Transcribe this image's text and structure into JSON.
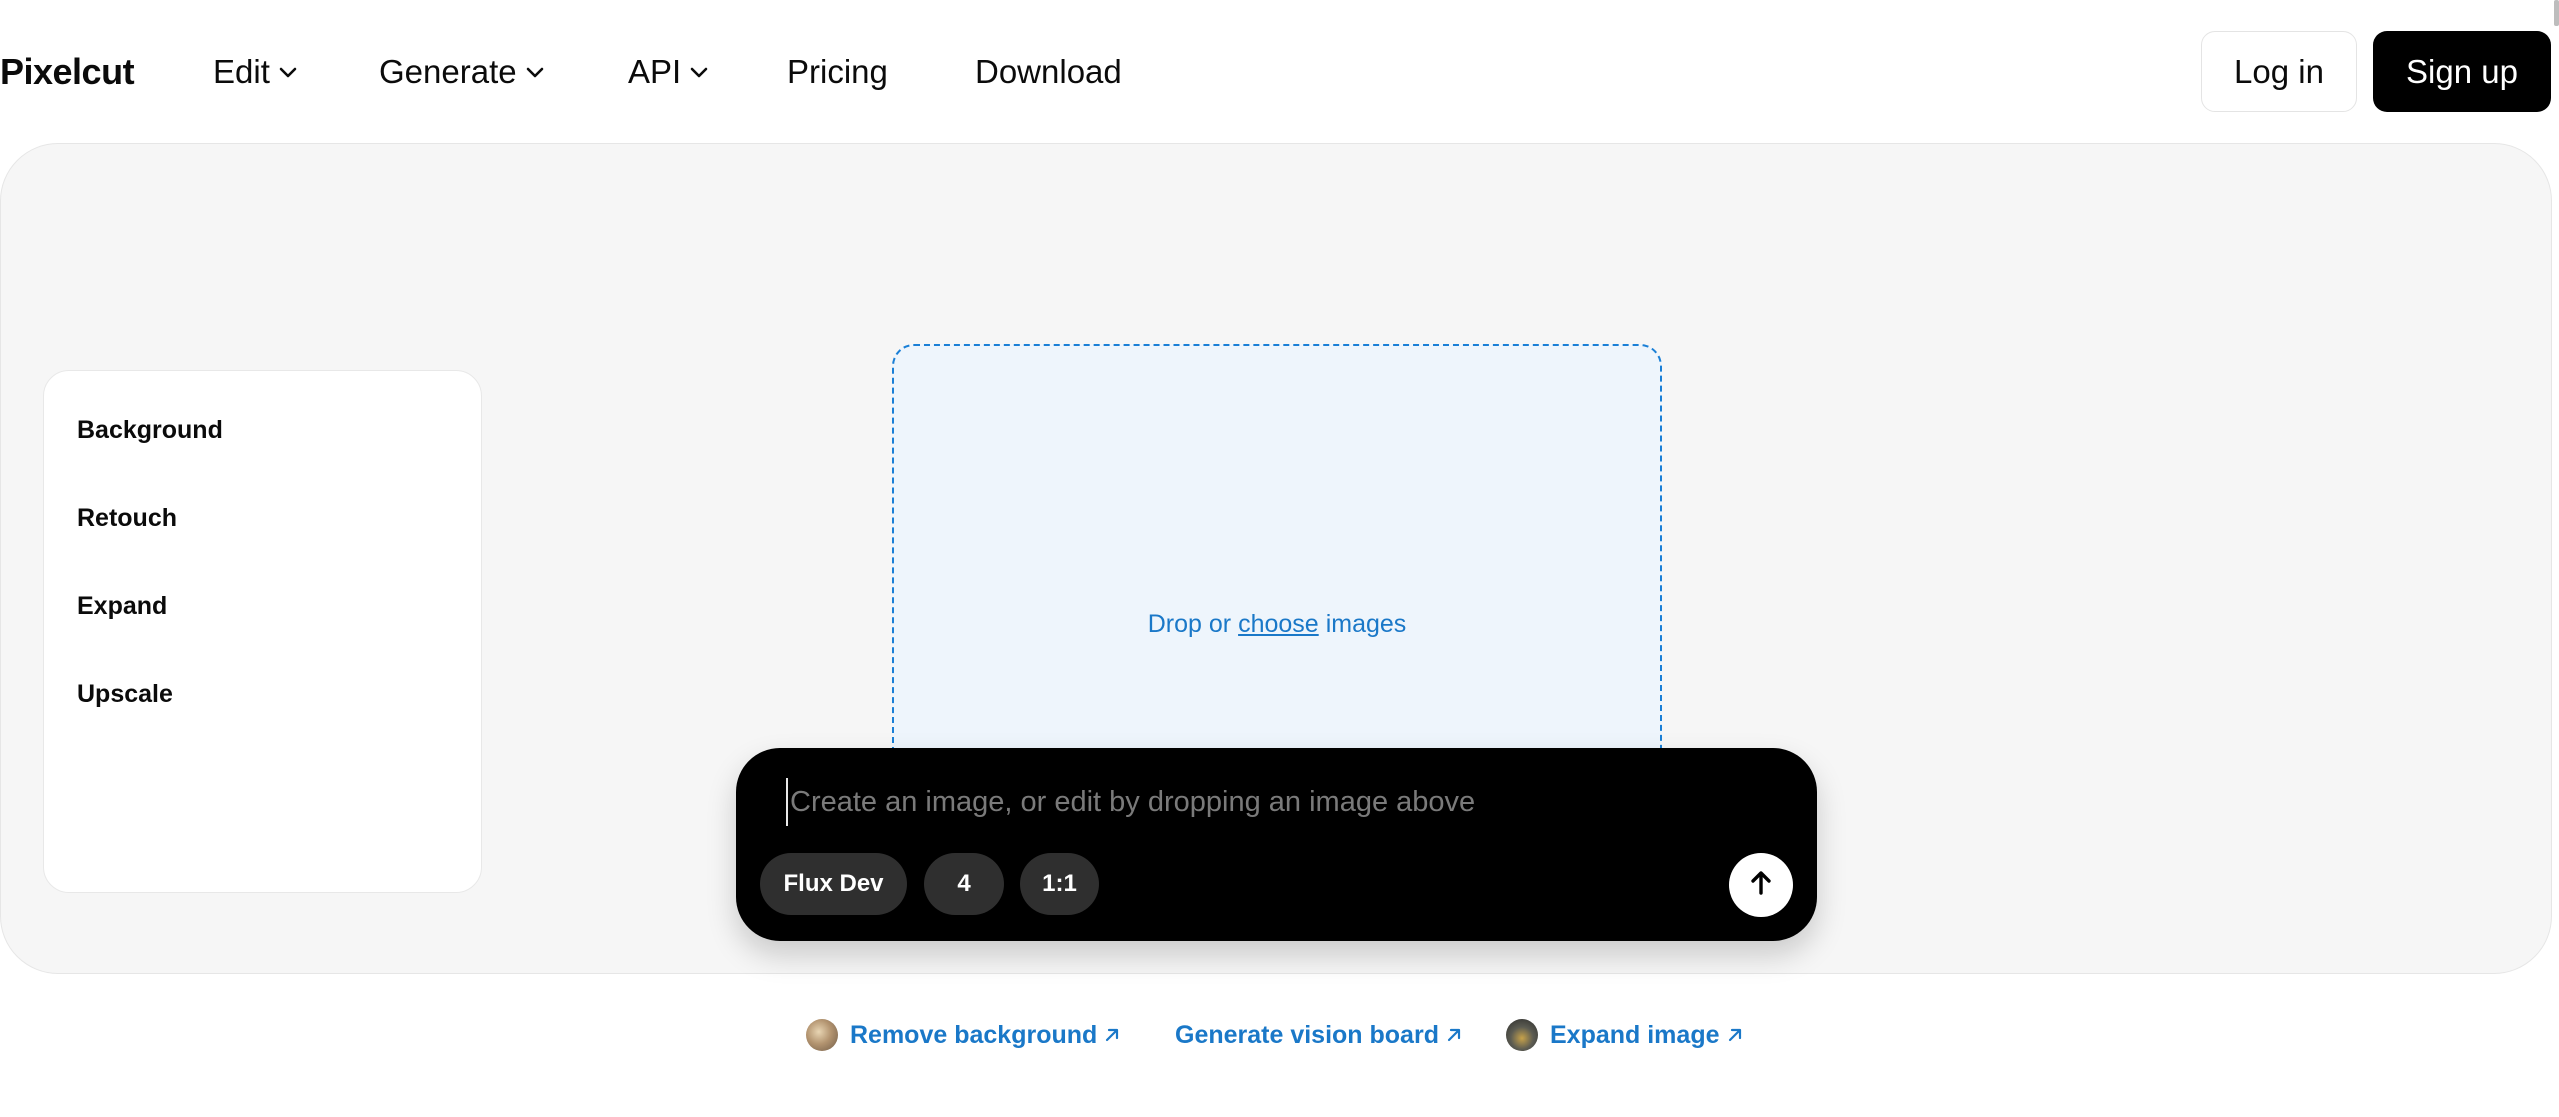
{
  "brand": "Pixelcut",
  "nav": {
    "items": [
      {
        "label": "Edit",
        "has_dropdown": true
      },
      {
        "label": "Generate",
        "has_dropdown": true
      },
      {
        "label": "API",
        "has_dropdown": true
      },
      {
        "label": "Pricing",
        "has_dropdown": false
      },
      {
        "label": "Download",
        "has_dropdown": false
      }
    ]
  },
  "auth": {
    "login_label": "Log in",
    "signup_label": "Sign up"
  },
  "side_menu": {
    "items": [
      "Background",
      "Retouch",
      "Expand",
      "Upscale"
    ]
  },
  "dropzone": {
    "prefix": "Drop or",
    "link": "choose",
    "suffix": "images",
    "accent": "#1a78c8"
  },
  "prompt": {
    "placeholder": "Create an image, or edit by dropping an image above",
    "value": "",
    "model": "Flux Dev",
    "count": "4",
    "aspect": "1:1"
  },
  "quick_links": [
    {
      "label": "Remove background",
      "thumb": "photo-thumb"
    },
    {
      "label": "Generate vision board",
      "thumb": null
    },
    {
      "label": "Expand image",
      "thumb": "photo-thumb"
    }
  ],
  "colors": {
    "link": "#1a78c8",
    "primary": "#000000",
    "panel_bg": "#f6f6f6",
    "dropzone_bg": "#eef5fc"
  }
}
